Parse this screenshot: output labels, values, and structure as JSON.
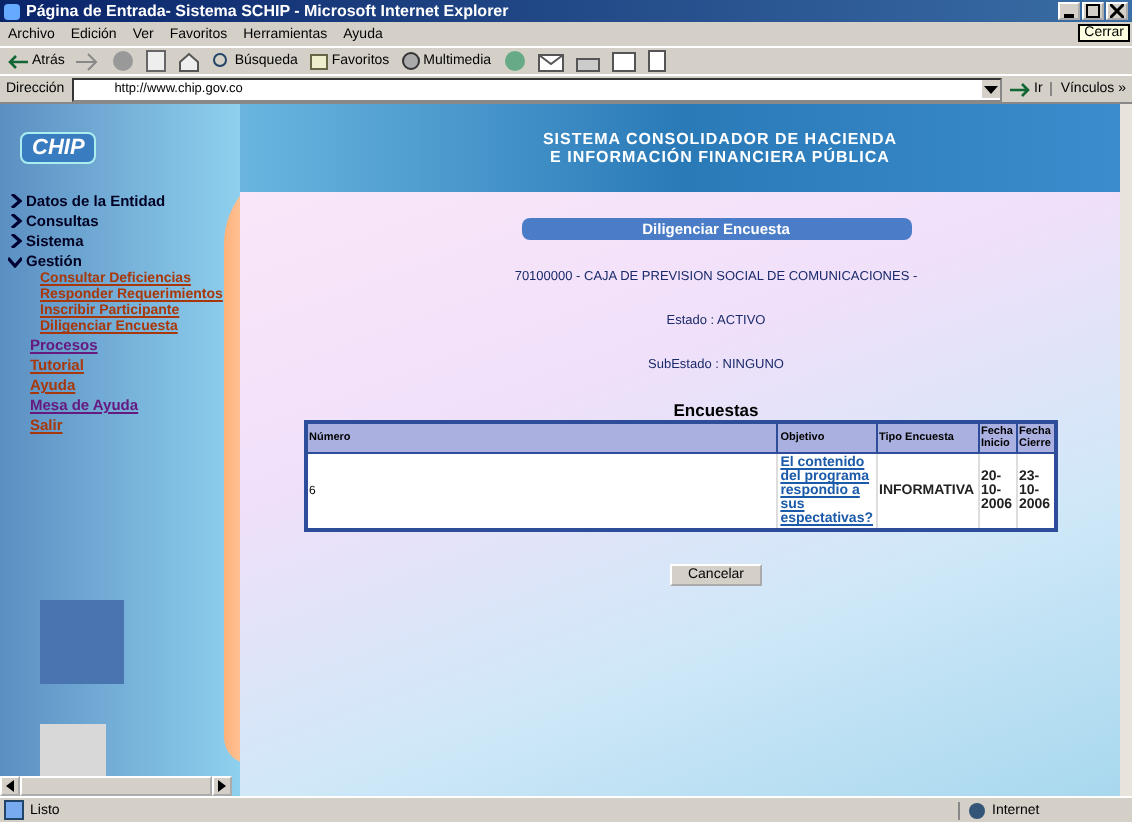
{
  "window": {
    "title": "Página de Entrada- Sistema SCHIP - Microsoft Internet Explorer",
    "tooltip": "Cerrar"
  },
  "menu": [
    "Archivo",
    "Edición",
    "Ver",
    "Favoritos",
    "Herramientas",
    "Ayuda"
  ],
  "toolbar": {
    "back": "Atrás",
    "search": "Búsqueda",
    "favorites": "Favoritos",
    "media": "Multimedia"
  },
  "address": {
    "label": "Dirección",
    "value": "http://www.chip.gov.co",
    "go": "Ir",
    "links": "Vínculos »"
  },
  "banner": {
    "logo": "CHIP",
    "lines": [
      "SISTEMA CONSOLIDADOR DE HACIENDA",
      "E INFORMACIÓN FINANCIERA PÚBLICA"
    ]
  },
  "sidebar": {
    "items": [
      {
        "kind": "section",
        "label": "Datos de la Entidad",
        "expanded": false
      },
      {
        "kind": "section",
        "label": "Consultas",
        "expanded": false
      },
      {
        "kind": "section",
        "label": "Sistema",
        "expanded": false
      },
      {
        "kind": "section",
        "label": "Gestión",
        "expanded": true,
        "children": [
          {
            "label": "Consultar Deficiencias",
            "visited": false
          },
          {
            "label": "Responder Requerimientos",
            "visited": false
          },
          {
            "label": "Inscribir Participante",
            "visited": false
          },
          {
            "label": "Diligenciar Encuesta",
            "visited": false
          }
        ]
      },
      {
        "kind": "link",
        "label": "Procesos",
        "visited": true
      },
      {
        "kind": "link",
        "label": "Tutorial",
        "visited": false
      },
      {
        "kind": "link",
        "label": "Ayuda",
        "visited": false
      },
      {
        "kind": "link",
        "label": "Mesa de Ayuda",
        "visited": true
      },
      {
        "kind": "link",
        "label": "Salir",
        "visited": false
      }
    ]
  },
  "main": {
    "title": "Diligenciar Encuesta",
    "entity": "70100000 - CAJA DE PREVISION SOCIAL DE COMUNICACIONES -",
    "estado": "Estado : ACTIVO",
    "subestado": "SubEstado : NINGUNO",
    "table": {
      "caption": "Encuestas",
      "columns": [
        "Número",
        "Objetivo",
        "Tipo Encuesta",
        "Fecha Inicio",
        "Fecha Cierre"
      ],
      "rows": [
        {
          "numero": "6",
          "objetivo": "El contenido del programa respondio a sus espectativas?",
          "tipo": "INFORMATIVA",
          "inicio": "20-10-2006",
          "cierre": "23-10-2006"
        }
      ]
    },
    "cancel": "Cancelar"
  },
  "status_bar": {
    "text": "Listo",
    "zone": "Internet"
  }
}
